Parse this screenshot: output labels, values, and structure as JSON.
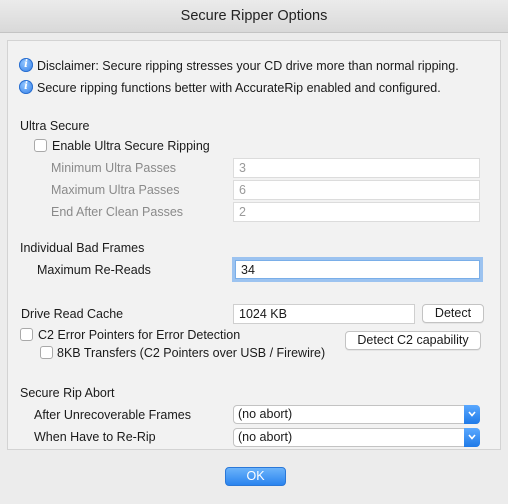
{
  "window": {
    "title": "Secure Ripper Options"
  },
  "disclaimer": {
    "line1": "Disclaimer: Secure ripping stresses your CD drive more than normal ripping.",
    "line2": "Secure ripping functions better with AccurateRip enabled and configured.",
    "icon": "info-icon"
  },
  "ultra_secure": {
    "title": "Ultra Secure",
    "enable_label": "Enable Ultra Secure Ripping",
    "enabled": false,
    "min_label": "Minimum Ultra Passes",
    "min_value": "3",
    "max_label": "Maximum Ultra Passes",
    "max_value": "6",
    "end_label": "End After Clean Passes",
    "end_value": "2"
  },
  "bad_frames": {
    "title": "Individual Bad Frames",
    "max_rereads_label": "Maximum Re-Reads",
    "max_rereads_value": "34"
  },
  "drive": {
    "cache_label": "Drive Read Cache",
    "cache_value": "1024 KB",
    "detect_button": "Detect",
    "c2_label": "C2 Error Pointers for Error Detection",
    "c2_checked": false,
    "detect_c2_button": "Detect C2 capability",
    "kb8_label": "8KB Transfers (C2 Pointers over USB / Firewire)",
    "kb8_checked": false
  },
  "abort": {
    "title": "Secure Rip Abort",
    "frames_label": "After Unrecoverable Frames",
    "frames_value": "(no abort)",
    "rerip_label": "When Have to Re-Rip",
    "rerip_value": "(no abort)"
  },
  "footer": {
    "ok_button": "OK"
  },
  "colors": {
    "accent": "#2a84ef",
    "focus_ring": "#9cc3f0"
  }
}
